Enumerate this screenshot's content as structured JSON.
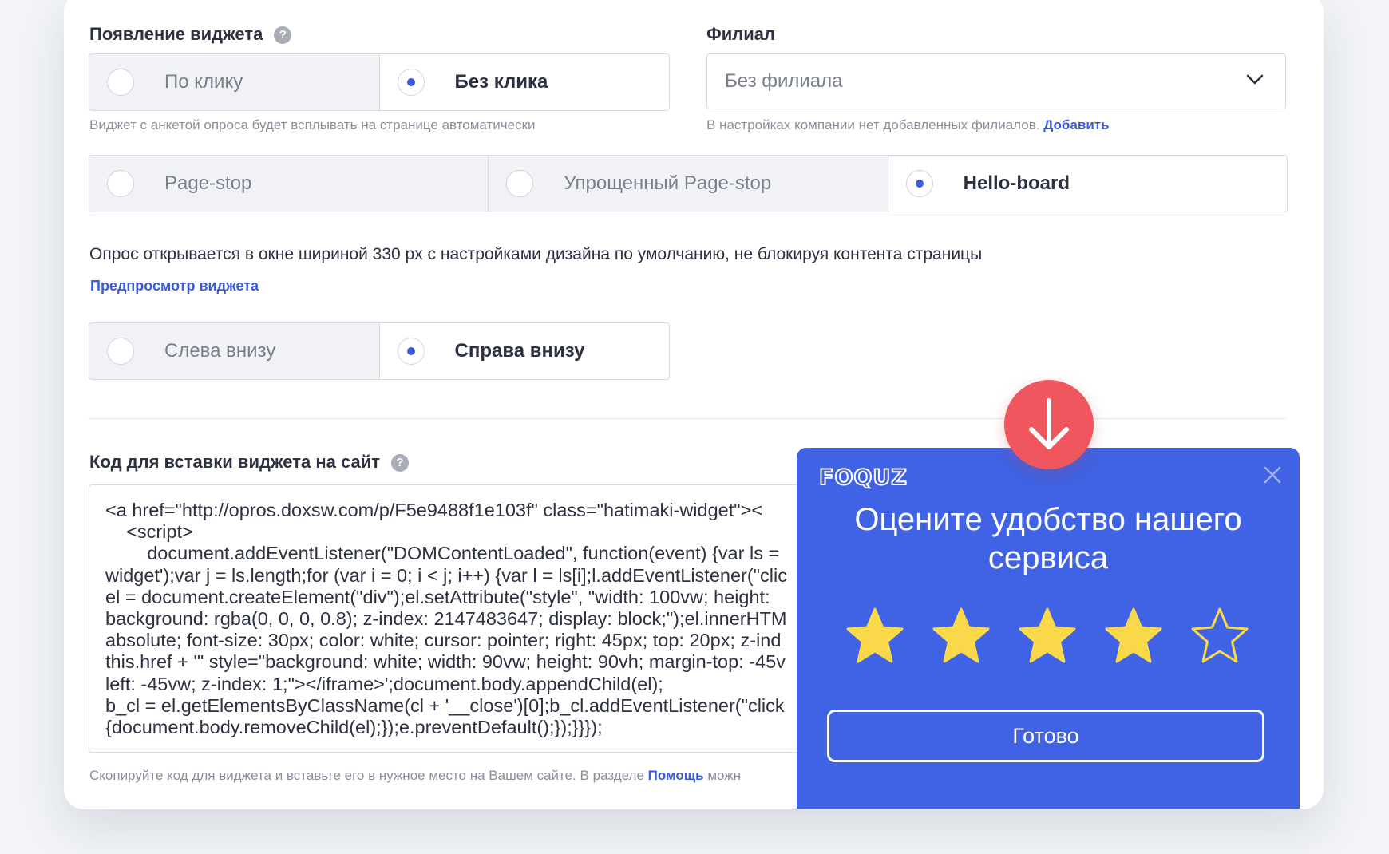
{
  "appearance": {
    "label": "Появление виджета",
    "help": "?",
    "options": [
      "По клику",
      "Без клика"
    ],
    "selected": 1,
    "hint": "Виджет с анкетой опроса будет всплывать на странице автоматически"
  },
  "branch": {
    "label": "Филиал",
    "value": "Без филиала",
    "hint": "В настройках компании нет добавленных филиалов.",
    "link": "Добавить"
  },
  "widget_type": {
    "options": [
      "Page-stop",
      "Упрощенный Page-stop",
      "Hello-board"
    ],
    "selected": 2,
    "description": "Опрос открывается в окне шириной 330 px с настройками дизайна по умолчанию, не блокируя контента страницы",
    "preview_link": "Предпросмотр виджета"
  },
  "position": {
    "options": [
      "Слева внизу",
      "Справа внизу"
    ],
    "selected": 1
  },
  "code": {
    "label": "Код для вставки виджета на сайт",
    "help": "?",
    "lines": [
      "<a href=\"http://opros.doxsw.com/p/F5e9488f1e103f\" class=\"hatimaki-widget\"><",
      "    <script>",
      "        document.addEventListener(\"DOMContentLoaded\", function(event) {var ls =",
      "widget');var j = ls.length;for (var i = 0; i < j; i++) {var l = ls[i];l.addEventListener(\"clic",
      "el = document.createElement(\"div\");el.setAttribute(\"style\", \"width: 100vw; height:",
      "background: rgba(0, 0, 0, 0.8); z-index: 2147483647; display: block;\");el.innerHTM",
      "absolute; font-size: 30px; color: white; cursor: pointer; right: 45px; top: 20px; z-ind",
      "this.href + '\" style=\"background: white; width: 90vw; height: 90vh; margin-top: -45v",
      "left: -45vw; z-index: 1;\"></iframe>';document.body.appendChild(el);",
      "b_cl = el.getElementsByClassName(cl + '__close')[0];b_cl.addEventListener(\"click",
      "{document.body.removeChild(el);});e.preventDefault();});}}});"
    ],
    "hint": "Скопируйте код для виджета и вставьте его в нужное место на Вашем сайте. В разделе",
    "hint_link": "Помощь",
    "hint_tail": "можн"
  },
  "popup": {
    "logo": "FOQUZ",
    "title": "Оцените удобство нашего сервиса",
    "rating": 4,
    "max_rating": 5,
    "button": "Готово"
  },
  "colors": {
    "accent": "#3b5bdb",
    "popup_bg": "#3f63e4",
    "star": "#f9d849",
    "badge": "#f0565e"
  }
}
